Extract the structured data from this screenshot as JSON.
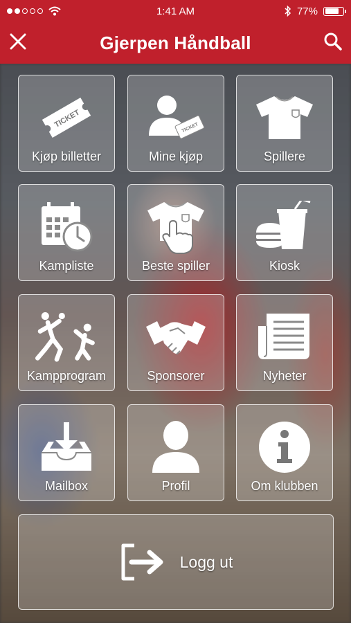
{
  "status_bar": {
    "time": "1:41 AM",
    "battery": "77%",
    "battery_level": 0.77,
    "signal_dots_filled": 2,
    "signal_dots_total": 5,
    "icons": [
      "signal-dots-icon",
      "wifi-icon",
      "bluetooth-icon",
      "battery-icon"
    ]
  },
  "header": {
    "title": "Gjerpen Håndball",
    "left_icon": "close-icon",
    "right_icon": "search-icon"
  },
  "menu": {
    "items": [
      {
        "label": "Kjøp billetter",
        "icon": "ticket-icon"
      },
      {
        "label": "Mine kjøp",
        "icon": "user-ticket-icon"
      },
      {
        "label": "Spillere",
        "icon": "jersey-icon"
      },
      {
        "label": "Kampliste",
        "icon": "calendar-clock-icon"
      },
      {
        "label": "Beste spiller",
        "icon": "jersey-tap-icon"
      },
      {
        "label": "Kiosk",
        "icon": "food-drink-icon"
      },
      {
        "label": "Kampprogram",
        "icon": "handball-players-icon"
      },
      {
        "label": "Sponsorer",
        "icon": "handshake-icon"
      },
      {
        "label": "Nyheter",
        "icon": "newspaper-icon"
      },
      {
        "label": "Mailbox",
        "icon": "inbox-download-icon"
      },
      {
        "label": "Profil",
        "icon": "person-icon"
      },
      {
        "label": "Om klubben",
        "icon": "info-icon"
      }
    ],
    "logout": {
      "label": "Logg ut",
      "icon": "logout-icon"
    }
  },
  "colors": {
    "brand_red": "#c0202c",
    "tile_border": "#ffffff",
    "text": "#ffffff"
  }
}
